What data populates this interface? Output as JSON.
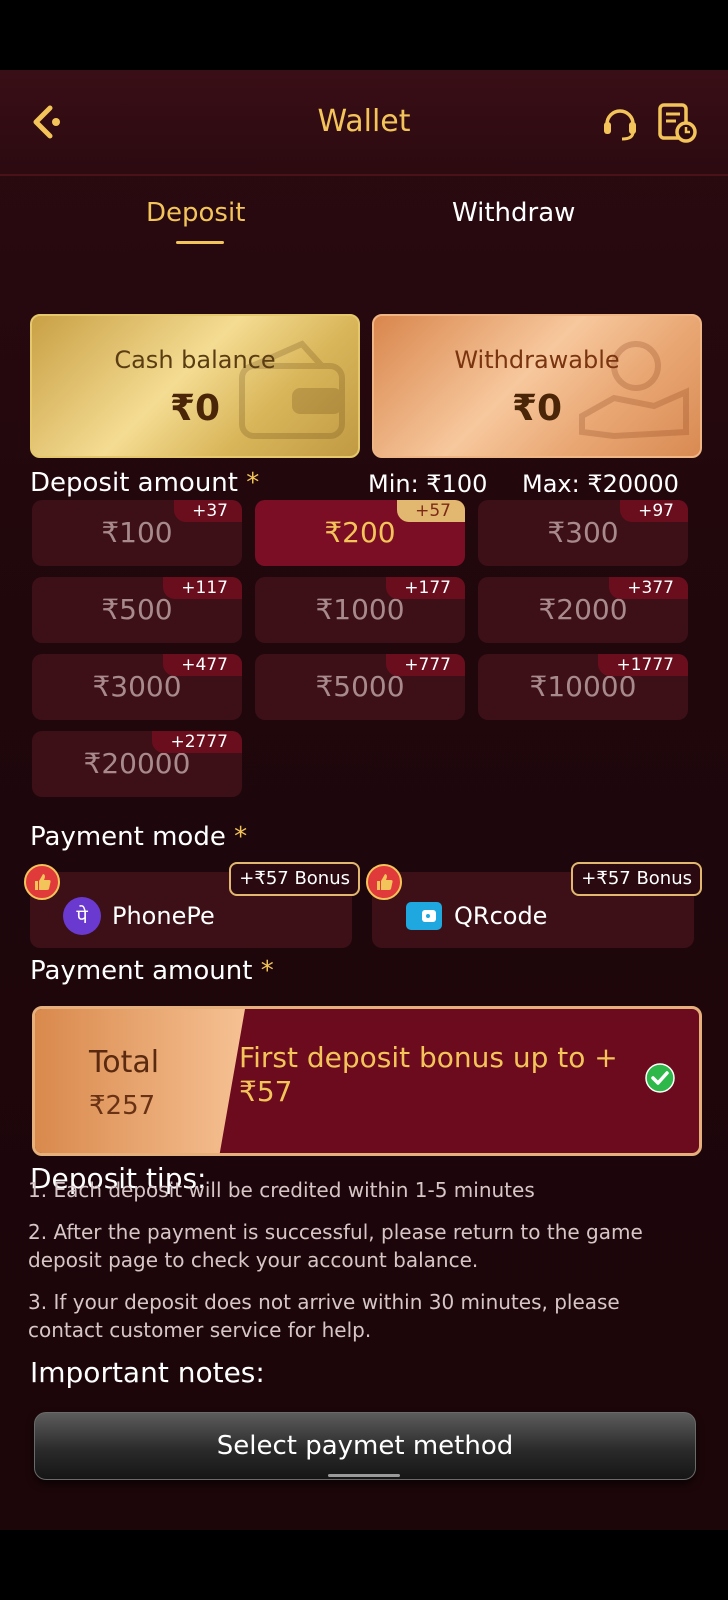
{
  "header": {
    "title": "Wallet",
    "back_icon": "chevron-left-icon",
    "support_icon": "headset-icon",
    "records_icon": "record-clock-icon"
  },
  "tabs": [
    {
      "label": "Deposit",
      "active": true
    },
    {
      "label": "Withdraw",
      "active": false
    }
  ],
  "balances": {
    "cash": {
      "label": "Cash balance",
      "value": "₹0"
    },
    "withdrawable": {
      "label": "Withdrawable",
      "value": "₹0"
    }
  },
  "deposit": {
    "label": "Deposit amount",
    "required_mark": "*",
    "min": "Min: ₹100",
    "max": "Max: ₹20000",
    "amounts": [
      {
        "value": "₹100",
        "bonus": "+37",
        "selected": false
      },
      {
        "value": "₹200",
        "bonus": "+57",
        "selected": true
      },
      {
        "value": "₹300",
        "bonus": "+97",
        "selected": false
      },
      {
        "value": "₹500",
        "bonus": "+117",
        "selected": false
      },
      {
        "value": "₹1000",
        "bonus": "+177",
        "selected": false
      },
      {
        "value": "₹2000",
        "bonus": "+377",
        "selected": false
      },
      {
        "value": "₹3000",
        "bonus": "+477",
        "selected": false
      },
      {
        "value": "₹5000",
        "bonus": "+777",
        "selected": false
      },
      {
        "value": "₹10000",
        "bonus": "+1777",
        "selected": false
      },
      {
        "value": "₹20000",
        "bonus": "+2777",
        "selected": false
      }
    ]
  },
  "payment_mode": {
    "label": "Payment mode",
    "required_mark": "*",
    "options": [
      {
        "label": "PhonePe",
        "bonus": "+₹57 Bonus",
        "icon": "phonepe-icon"
      },
      {
        "label": "QRcode",
        "bonus": "+₹57 Bonus",
        "icon": "qrcode-wallet-icon"
      }
    ]
  },
  "payment_amount": {
    "label": "Payment amount",
    "required_mark": "*",
    "total_label": "Total",
    "total_value": "₹257",
    "bonus_text": "First deposit bonus up to +₹57"
  },
  "tips": {
    "title": "Deposit tips:",
    "items": [
      "1. Each deposit will be credited within 1-5 minutes",
      "2. After the payment is successful, please return to the game deposit page to check your account balance.",
      "3. If your deposit does not arrive within 30 minutes, please contact customer service for help."
    ],
    "notes_title": "Important notes:"
  },
  "footer": {
    "button_label": "Select paymet method"
  },
  "colors": {
    "accent_gold": "#f3c45a",
    "background": "#1f070c",
    "selected_red": "#7b0e25"
  }
}
